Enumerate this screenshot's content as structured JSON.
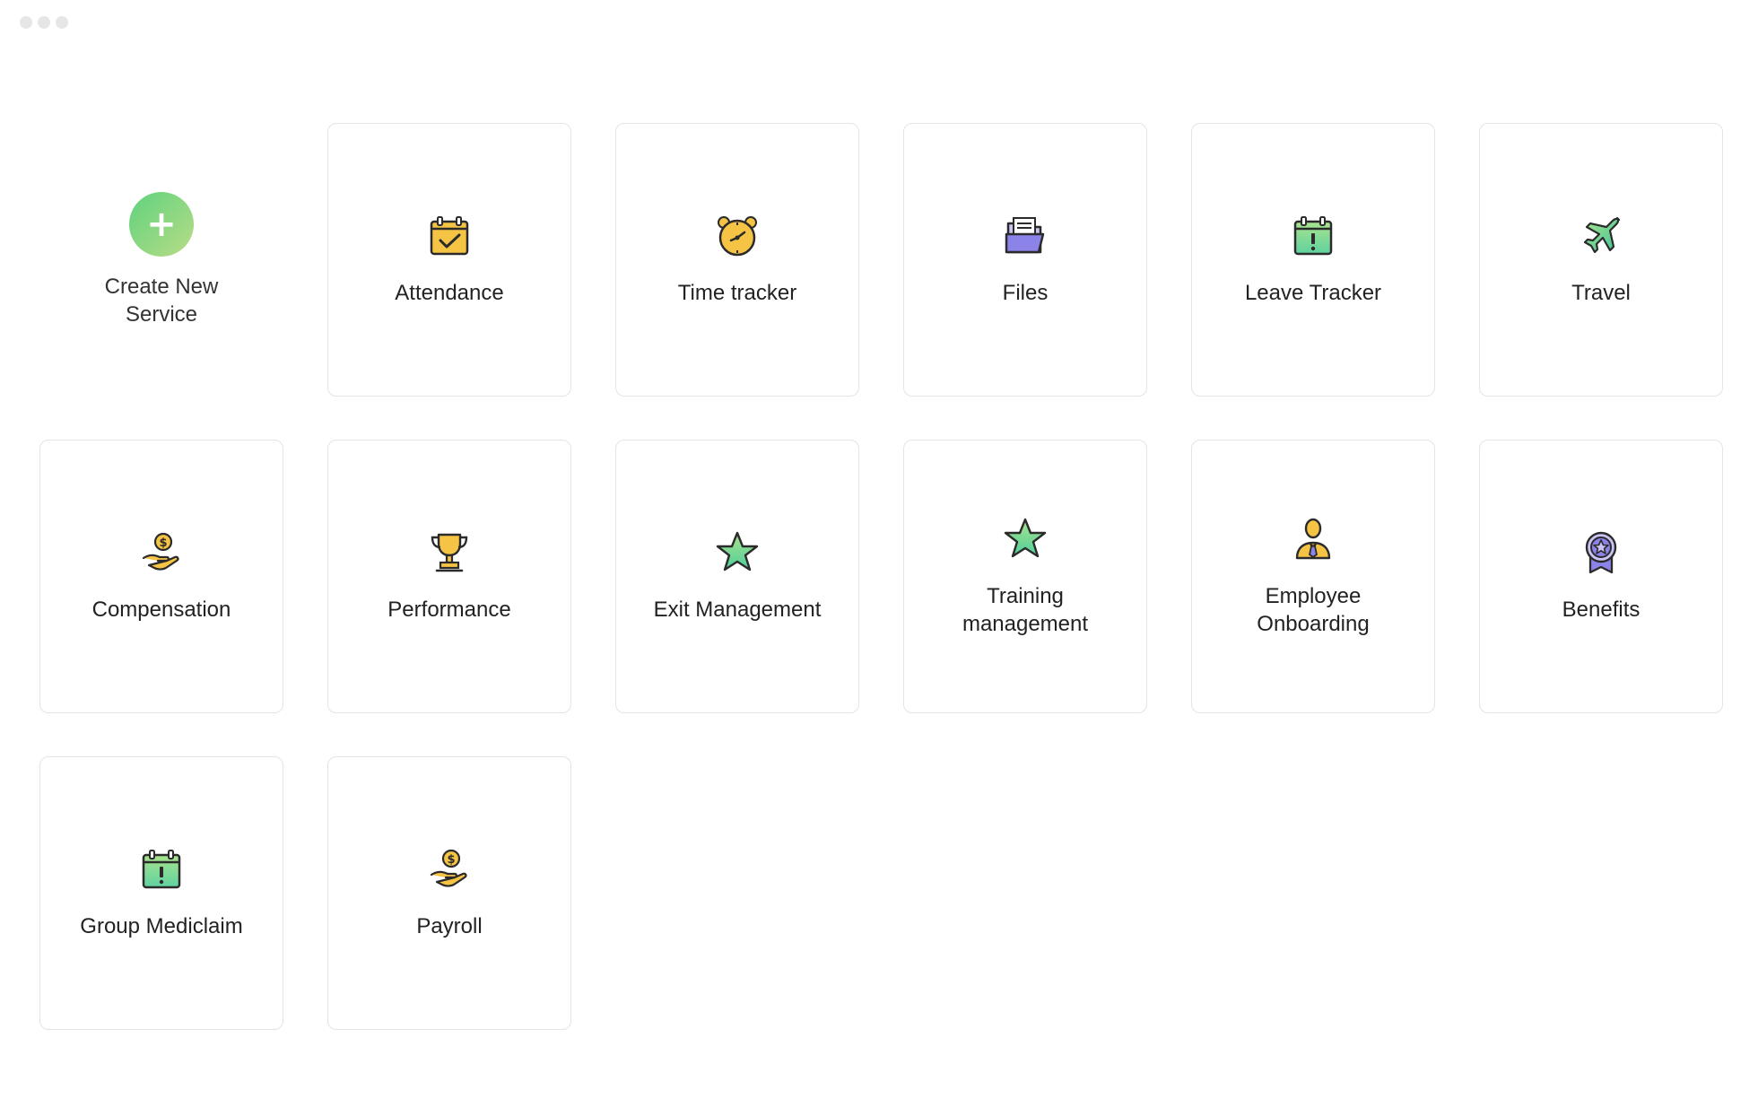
{
  "create": {
    "label": "Create New\nService",
    "icon": "plus-icon"
  },
  "services": [
    {
      "label": "Attendance",
      "icon": "calendar-check-icon"
    },
    {
      "label": "Time tracker",
      "icon": "alarm-clock-icon"
    },
    {
      "label": "Files",
      "icon": "folder-icon"
    },
    {
      "label": "Leave Tracker",
      "icon": "calendar-alert-icon"
    },
    {
      "label": "Travel",
      "icon": "airplane-icon"
    },
    {
      "label": "Compensation",
      "icon": "hand-coin-icon"
    },
    {
      "label": "Performance",
      "icon": "trophy-icon"
    },
    {
      "label": "Exit Management",
      "icon": "star-icon"
    },
    {
      "label": "Training\nmanagement",
      "icon": "star-icon"
    },
    {
      "label": "Employee\nOnboarding",
      "icon": "employee-icon"
    },
    {
      "label": "Benefits",
      "icon": "badge-icon"
    },
    {
      "label": "Group Mediclaim",
      "icon": "calendar-alert-icon"
    },
    {
      "label": "Payroll",
      "icon": "hand-coin-icon"
    }
  ],
  "colors": {
    "accent_green": "#5fd27e",
    "icon_yellow": "#f6c445",
    "icon_purple": "#8b83e8",
    "icon_outline": "#2b2b2b"
  }
}
